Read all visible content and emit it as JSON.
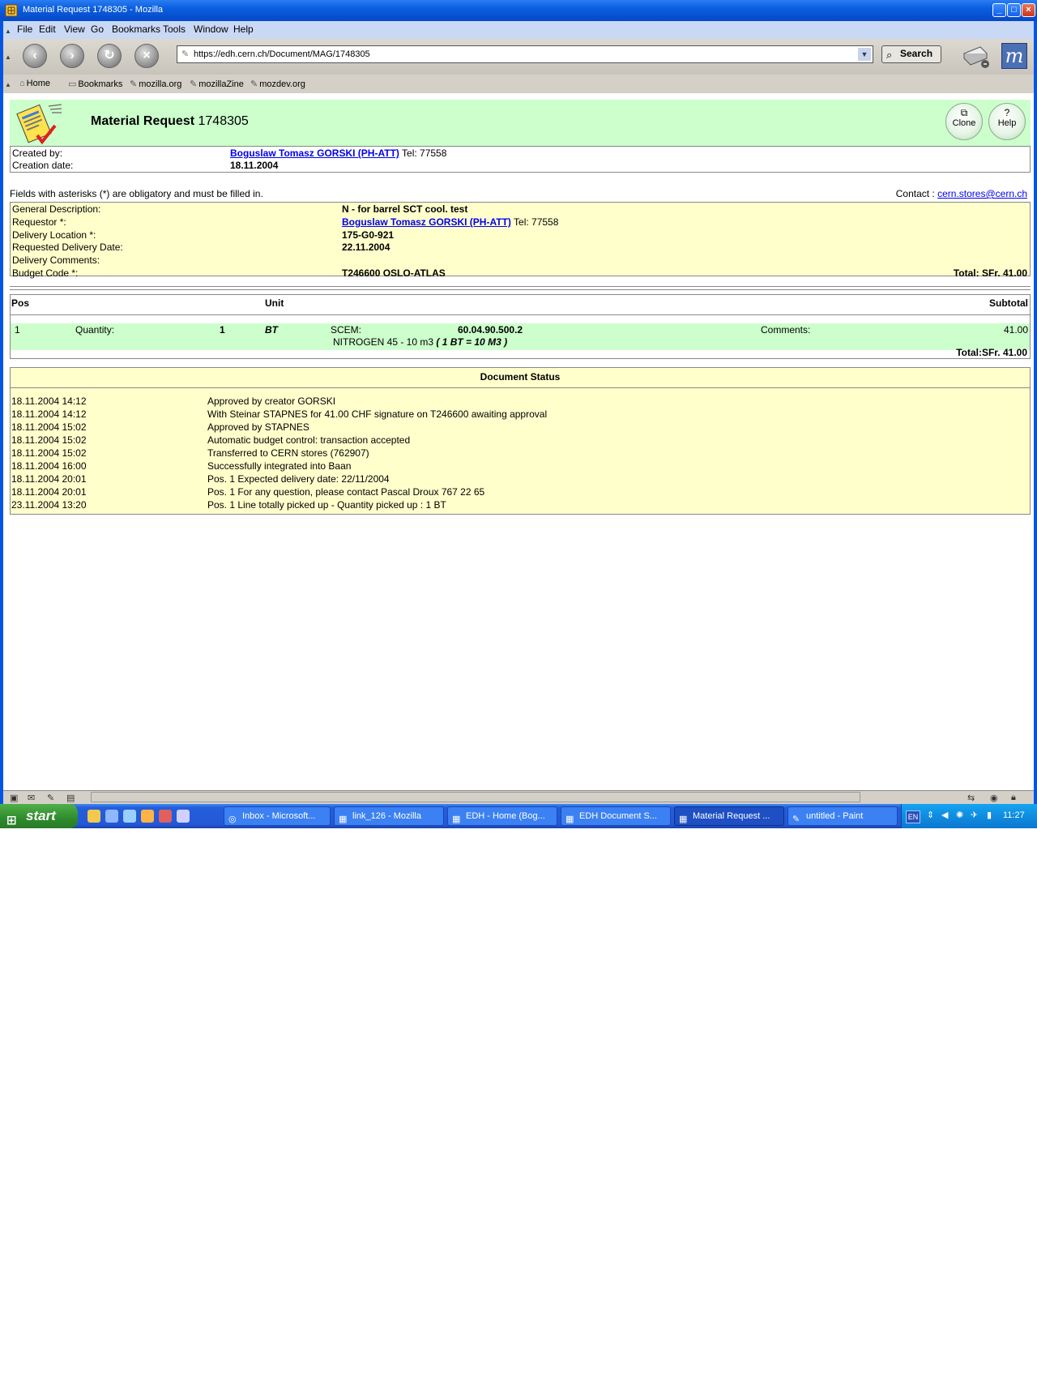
{
  "window": {
    "title": "Material Request 1748305 - Mozilla"
  },
  "menu": [
    "File",
    "Edit",
    "View",
    "Go",
    "Bookmarks",
    "Tools",
    "Window",
    "Help"
  ],
  "navigation": {
    "url": "https://edh.cern.ch/Document/MAG/1748305",
    "search_label": "Search"
  },
  "personal_bar": [
    "Home",
    "Bookmarks",
    "mozilla.org",
    "mozillaZine",
    "mozdev.org"
  ],
  "page": {
    "title_bold": "Material Request",
    "title_number": "1748305",
    "clone_label": "Clone",
    "help_label": "Help",
    "created_by_label": "Created by:",
    "created_by_name": "Boguslaw Tomasz GORSKI (PH-ATT)",
    "created_by_tel": "Tel: 77558",
    "creation_date_label": "Creation date:",
    "creation_date": "18.11.2004",
    "obligatory_note": "Fields with asterisks (*) are obligatory and must be filled in.",
    "contact_label": "Contact :",
    "contact_email": "cern.stores@cern.ch"
  },
  "details": {
    "general_description_label": "General Description:",
    "general_description": "N - for barrel SCT cool. test",
    "requestor_label": "Requestor *:",
    "requestor_name": "Boguslaw Tomasz GORSKI (PH-ATT)",
    "requestor_tel": "Tel: 77558",
    "delivery_location_label": "Delivery Location *:",
    "delivery_location": "175-G0-921",
    "requested_delivery_date_label": "Requested Delivery Date:",
    "requested_delivery_date": "22.11.2004",
    "delivery_comments_label": "Delivery Comments:",
    "budget_code_label": "Budget Code *:",
    "budget_code": "T246600 OSLO-ATLAS",
    "total": "Total: SFr. 41.00"
  },
  "items": {
    "headers": {
      "pos": "Pos",
      "unit": "Unit",
      "subtotal": "Subtotal"
    },
    "row": {
      "pos": "1",
      "quantity_label": "Quantity:",
      "quantity": "1",
      "unit": "BT",
      "scem_label": "SCEM:",
      "scem": "60.04.90.500.2",
      "description": "NITROGEN 45 - 10 m3",
      "conversion": "( 1 BT = 10 M3 )",
      "comments_label": "Comments:",
      "subtotal": "41.00"
    },
    "total": "Total:SFr. 41.00"
  },
  "status": {
    "title": "Document Status",
    "entries": [
      {
        "date": "18.11.2004 14:12",
        "text": "Approved by creator GORSKI"
      },
      {
        "date": "18.11.2004 14:12",
        "text": "With Steinar STAPNES for 41.00 CHF signature on T246600 awaiting approval"
      },
      {
        "date": "18.11.2004 15:02",
        "text": "Approved by STAPNES"
      },
      {
        "date": "18.11.2004 15:02",
        "text": "Automatic budget control: transaction accepted"
      },
      {
        "date": "18.11.2004 15:02",
        "text": "Transferred to CERN stores (762907)"
      },
      {
        "date": "18.11.2004 16:00",
        "text": "Successfully integrated into Baan"
      },
      {
        "date": "18.11.2004 20:01",
        "text": "Pos. 1 Expected delivery date: 22/11/2004"
      },
      {
        "date": "18.11.2004 20:01",
        "text": "Pos. 1 For any question, please contact Pascal Droux 767 22 65"
      },
      {
        "date": "23.11.2004 13:20",
        "text": "Pos. 1 Line totally picked up - Quantity picked up : 1 BT"
      }
    ]
  },
  "taskbar": {
    "start_label": "start",
    "tasks": [
      "Inbox - Microsoft...",
      "link_126 - Mozilla",
      "EDH - Home (Bog...",
      "EDH Document S...",
      "Material Request ...",
      "untitled - Paint"
    ],
    "language": "EN",
    "clock": "11:27"
  }
}
